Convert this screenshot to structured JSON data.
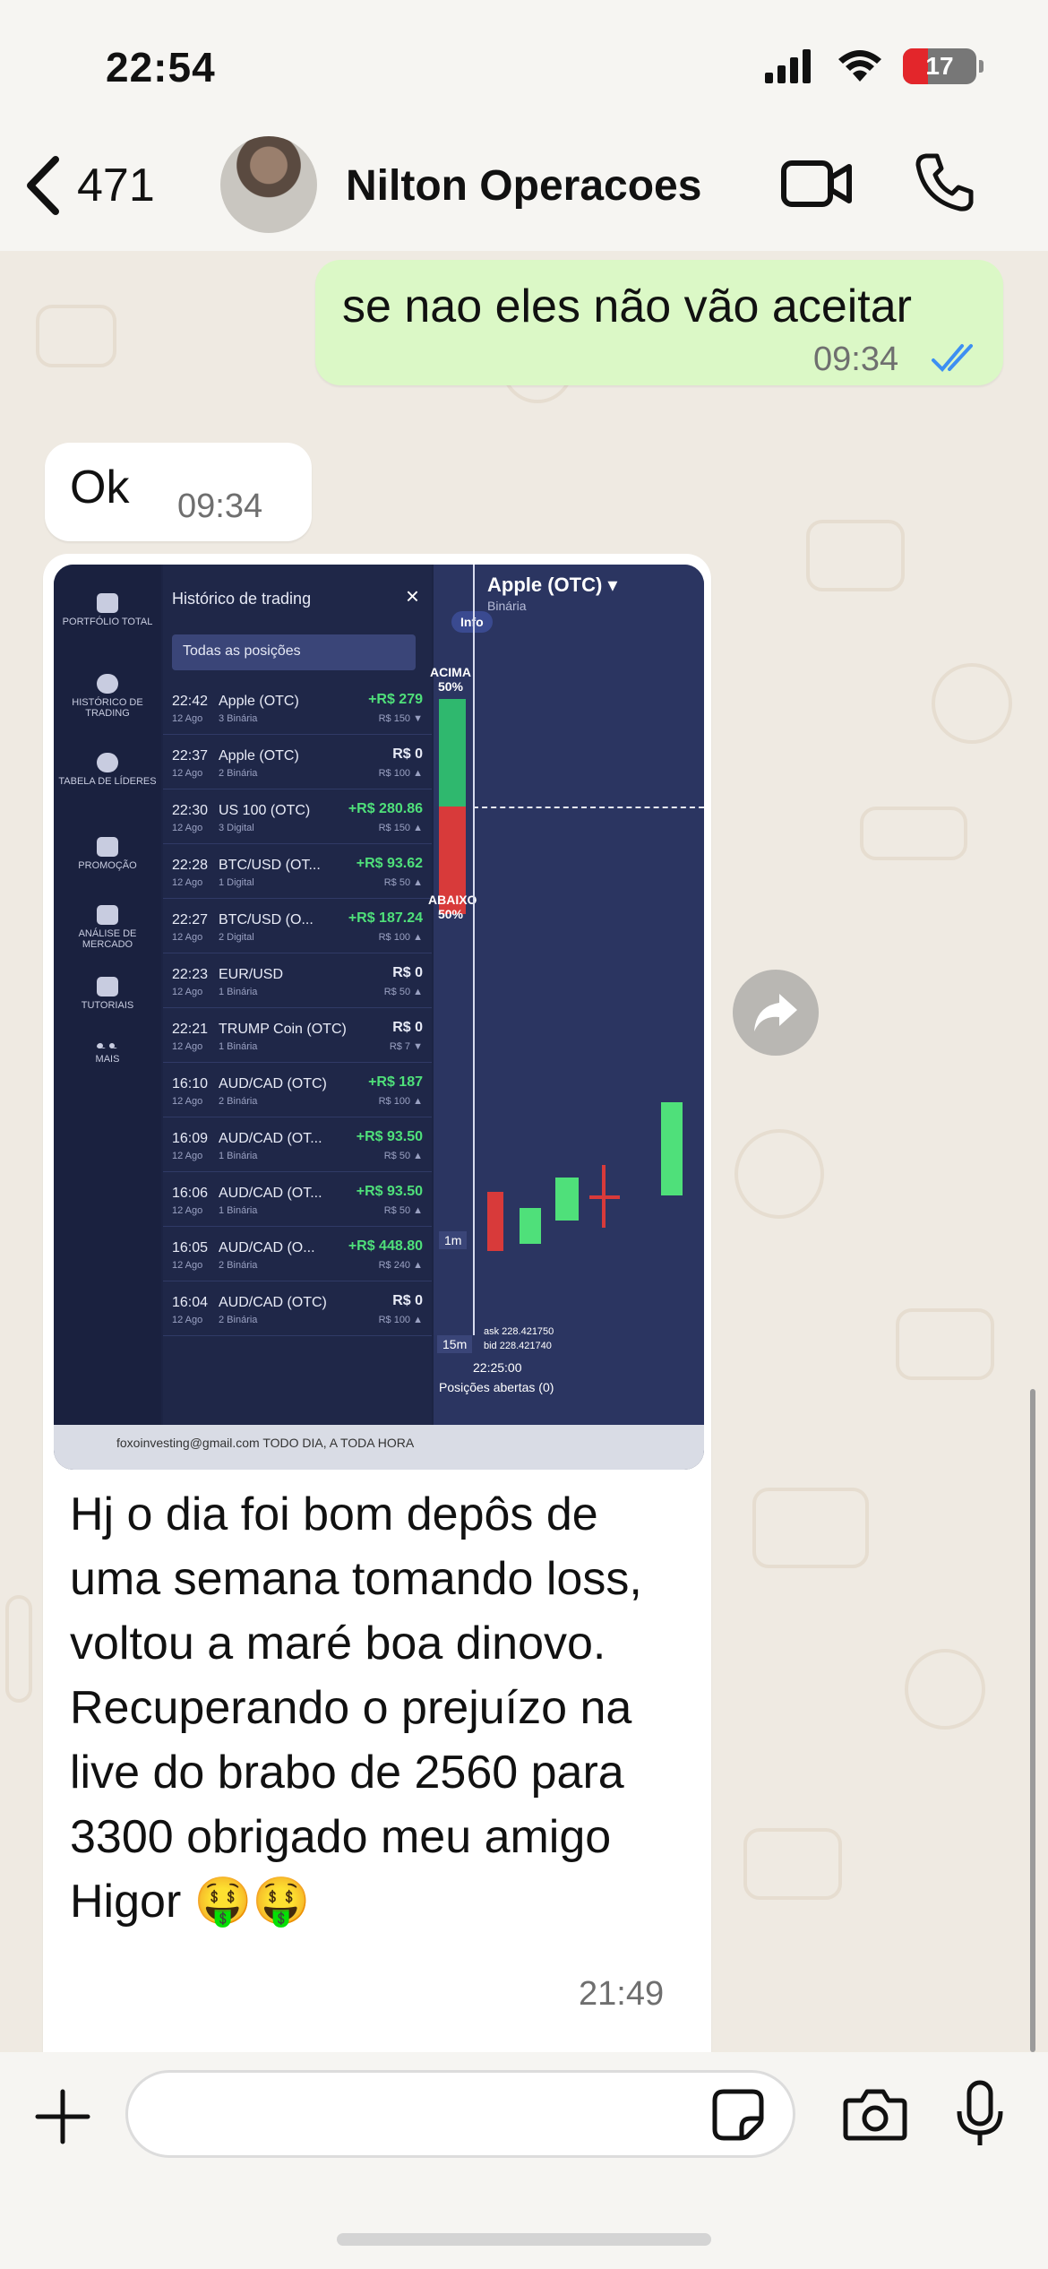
{
  "status_bar": {
    "time": "22:54",
    "battery_level": "17",
    "battery_color": "#e3262b"
  },
  "header": {
    "back_count": "471",
    "contact_name": "Nilton Operacoes"
  },
  "messages": [
    {
      "direction": "outgoing",
      "text": "se nao eles não vão aceitar",
      "time": "09:34",
      "status": "read"
    },
    {
      "direction": "incoming",
      "text": "Ok",
      "time": "09:34"
    },
    {
      "direction": "incoming",
      "type": "image",
      "caption": "Hj o dia foi bom depôs de uma semana tomando loss, voltou a maré boa dinovo. Recuperando o prejuízo na live do brabo de 2560 para 3300 obrigado meu amigo Higor 🤑🤑",
      "time": "21:49"
    }
  ],
  "screenshot": {
    "sidebar": [
      "PORTFÓLIO TOTAL",
      "HISTÓRICO DE TRADING",
      "TABELA DE LÍDERES",
      "PROMOÇÃO",
      "ANÁLISE DE MERCADO",
      "TUTORIAIS",
      "MAIS"
    ],
    "history_title": "Histórico de trading",
    "filter": "Todas as posições",
    "trades": [
      {
        "time": "22:42",
        "date": "12 Ago",
        "asset": "Apple (OTC)",
        "type": "3 Binária",
        "profit": "+R$ 279",
        "invest": "R$ 150 ▼"
      },
      {
        "time": "22:37",
        "date": "12 Ago",
        "asset": "Apple (OTC)",
        "type": "2 Binária",
        "profit": "R$ 0",
        "invest": "R$ 100 ▲"
      },
      {
        "time": "22:30",
        "date": "12 Ago",
        "asset": "US 100 (OTC)",
        "type": "3 Digital",
        "profit": "+R$ 280.86",
        "invest": "R$ 150 ▲"
      },
      {
        "time": "22:28",
        "date": "12 Ago",
        "asset": "BTC/USD (OT...",
        "type": "1 Digital",
        "profit": "+R$ 93.62",
        "invest": "R$ 50 ▲"
      },
      {
        "time": "22:27",
        "date": "12 Ago",
        "asset": "BTC/USD (O...",
        "type": "2 Digital",
        "profit": "+R$ 187.24",
        "invest": "R$ 100 ▲"
      },
      {
        "time": "22:23",
        "date": "12 Ago",
        "asset": "EUR/USD",
        "type": "1 Binária",
        "profit": "R$ 0",
        "invest": "R$ 50 ▲"
      },
      {
        "time": "22:21",
        "date": "12 Ago",
        "asset": "TRUMP Coin (OTC)",
        "type": "1 Binária",
        "profit": "R$ 0",
        "invest": "R$ 7 ▼"
      },
      {
        "time": "16:10",
        "date": "12 Ago",
        "asset": "AUD/CAD (OTC)",
        "type": "2 Binária",
        "profit": "+R$ 187",
        "invest": "R$ 100 ▲"
      },
      {
        "time": "16:09",
        "date": "12 Ago",
        "asset": "AUD/CAD (OT...",
        "type": "1 Binária",
        "profit": "+R$ 93.50",
        "invest": "R$ 50 ▲"
      },
      {
        "time": "16:06",
        "date": "12 Ago",
        "asset": "AUD/CAD (OT...",
        "type": "1 Binária",
        "profit": "+R$ 93.50",
        "invest": "R$ 50 ▲"
      },
      {
        "time": "16:05",
        "date": "12 Ago",
        "asset": "AUD/CAD (O...",
        "type": "2 Binária",
        "profit": "+R$ 448.80",
        "invest": "R$ 240 ▲"
      },
      {
        "time": "16:04",
        "date": "12 Ago",
        "asset": "AUD/CAD (OTC)",
        "type": "2 Binária",
        "profit": "R$ 0",
        "invest": "R$ 100 ▲"
      }
    ],
    "asset_name": "Apple (OTC) ▾",
    "asset_type": "Binária",
    "info_label": "Info",
    "above_label": "ACIMA 50%",
    "below_label": "ABAIXO 50%",
    "timeframes": [
      "1m",
      "15m"
    ],
    "ask": "ask 228.421750",
    "bid": "bid 228.421740",
    "chart_time": "22:25:00",
    "open_positions": "Posições abertas (0)",
    "footer": "foxoinvesting@gmail.com   TODO DIA, A TODA HORA"
  },
  "input": {
    "placeholder": ""
  }
}
